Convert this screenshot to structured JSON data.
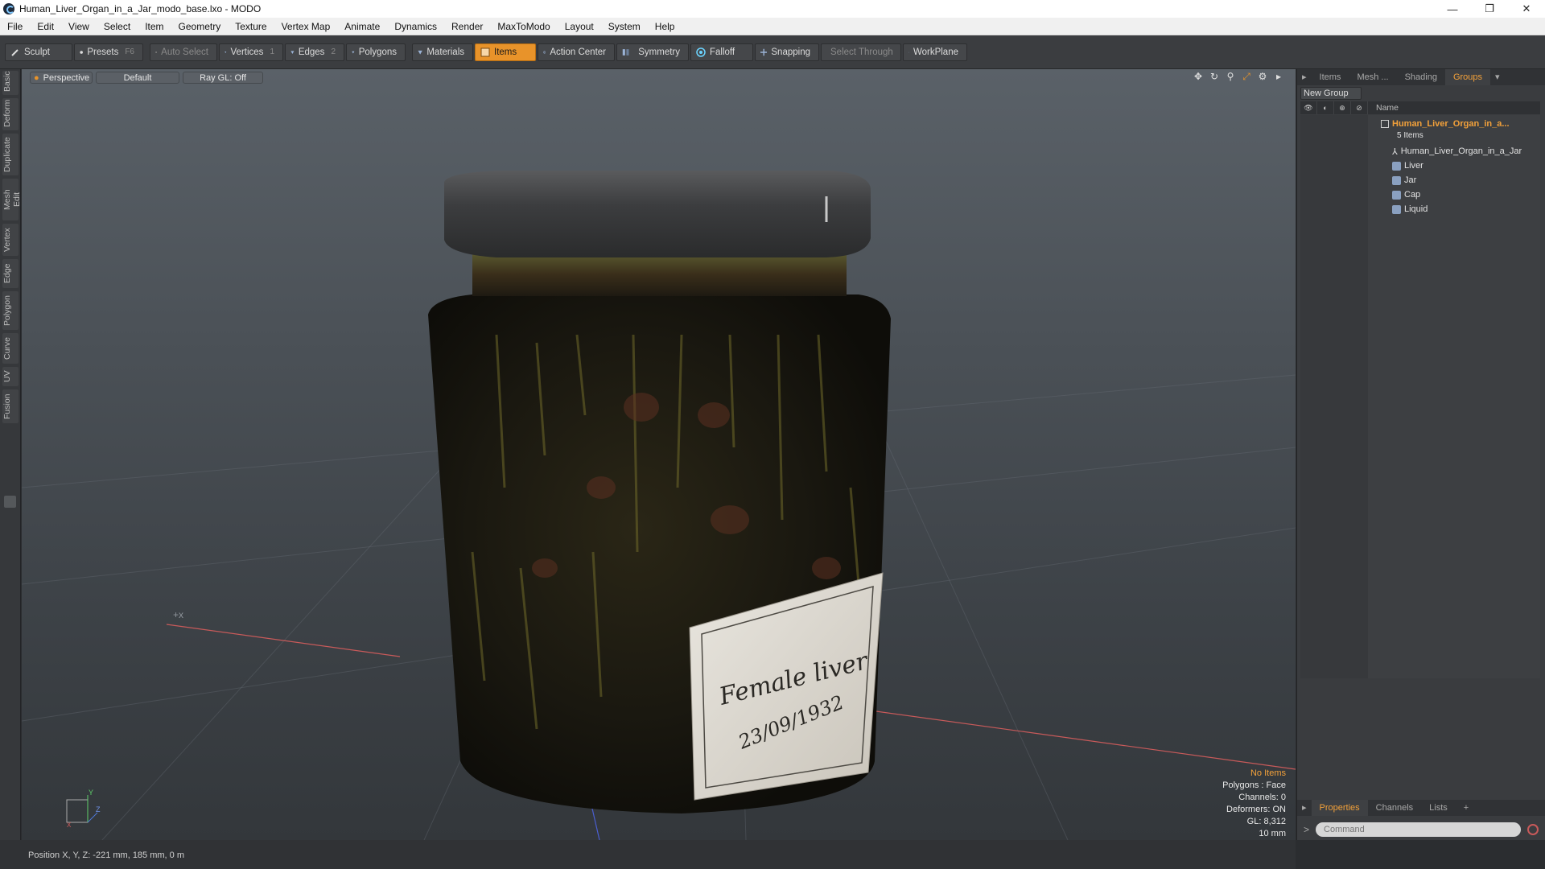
{
  "window": {
    "title": "Human_Liver_Organ_in_a_Jar_modo_base.lxo - MODO",
    "minimize": "—",
    "restore": "❐",
    "close": "✕"
  },
  "menu": [
    "File",
    "Edit",
    "View",
    "Select",
    "Item",
    "Geometry",
    "Texture",
    "Vertex Map",
    "Animate",
    "Dynamics",
    "Render",
    "MaxToModo",
    "Layout",
    "System",
    "Help"
  ],
  "toolbar": {
    "sculpt": "Sculpt",
    "presets": "Presets",
    "presets_key": "F6",
    "auto_select": "Auto Select",
    "vertices": "Vertices",
    "vertices_key": "1",
    "edges": "Edges",
    "edges_key": "2",
    "polygons": "Polygons",
    "materials": "Materials",
    "items": "Items",
    "action_center": "Action Center",
    "symmetry": "Symmetry",
    "falloff": "Falloff",
    "snapping": "Snapping",
    "select_through": "Select Through",
    "workplane": "WorkPlane"
  },
  "left_tabs": [
    "Basic",
    "Deform",
    "Duplicate",
    "Mesh Edit",
    "Vertex",
    "Edge",
    "Polygon",
    "Curve",
    "UV",
    "Fusion"
  ],
  "viewport": {
    "view": "Perspective",
    "shading": "Default",
    "raygl": "Ray GL: Off",
    "label_line1": "Female liver",
    "label_line2": "23/09/1932",
    "stats": {
      "no_items": "No Items",
      "polygons": "Polygons : Face",
      "channels": "Channels: 0",
      "deformers": "Deformers: ON",
      "gl": "GL: 8,312",
      "grid": "10 mm"
    },
    "axis": {
      "y": "Y",
      "z": "Z",
      "x": "X"
    }
  },
  "right_panel": {
    "tabs": [
      "Items",
      "Mesh ...",
      "Shading",
      "Groups"
    ],
    "active_tab": "Groups",
    "new_group": "New Group",
    "col_name": "Name",
    "group_name": "Human_Liver_Organ_in_a...",
    "group_count": "5 Items",
    "children": [
      "Human_Liver_Organ_in_a_Jar",
      "Liver",
      "Jar",
      "Cap",
      "Liquid"
    ],
    "bottom_tabs": [
      "Properties",
      "Channels",
      "Lists",
      "+"
    ],
    "active_bottom_tab": "Properties",
    "command_placeholder": "Command"
  },
  "status": {
    "position": "Position X, Y, Z:  -221 mm, 185 mm, 0 m"
  },
  "colors": {
    "accent": "#e8932a",
    "group_text": "#f3a13a"
  }
}
